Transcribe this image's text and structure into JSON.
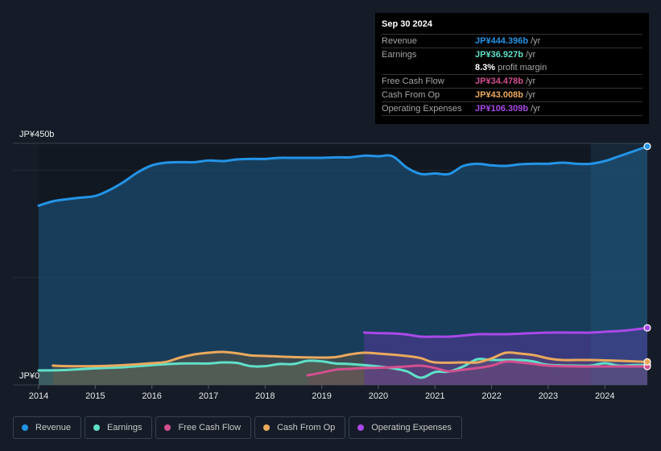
{
  "tooltip": {
    "date": "Sep 30 2024",
    "rows": [
      {
        "label": "Revenue",
        "value": "JP¥444.396b",
        "unit": "/yr",
        "color": "#2394e6"
      },
      {
        "label": "Earnings",
        "value": "JP¥36.927b",
        "unit": "/yr",
        "color": "#5fe0c8"
      },
      {
        "label": "",
        "value": "8.3%",
        "unit": "profit margin",
        "color": "#ffffff"
      },
      {
        "label": "Free Cash Flow",
        "value": "JP¥34.478b",
        "unit": "/yr",
        "color": "#d34f8f"
      },
      {
        "label": "Cash From Op",
        "value": "JP¥43.008b",
        "unit": "/yr",
        "color": "#eaa95d"
      },
      {
        "label": "Operating Expenses",
        "value": "JP¥106.309b",
        "unit": "/yr",
        "color": "#a949e8"
      }
    ]
  },
  "legend": [
    {
      "label": "Revenue",
      "color": "#2394e6"
    },
    {
      "label": "Earnings",
      "color": "#5fe0c8"
    },
    {
      "label": "Free Cash Flow",
      "color": "#d34f8f"
    },
    {
      "label": "Cash From Op",
      "color": "#eaa95d"
    },
    {
      "label": "Operating Expenses",
      "color": "#a949e8"
    }
  ],
  "chart_data": {
    "type": "area",
    "title": "",
    "xlabel": "",
    "ylabel": "",
    "y_tick_labels": [
      "JP¥0",
      "JP¥450b"
    ],
    "ylim": [
      0,
      450
    ],
    "xlim": [
      2014,
      2024.75
    ],
    "x_ticks": [
      2014,
      2015,
      2016,
      2017,
      2018,
      2019,
      2020,
      2021,
      2022,
      2023,
      2024
    ],
    "x_tick_labels": [
      "2014",
      "2015",
      "2016",
      "2017",
      "2018",
      "2019",
      "2020",
      "2021",
      "2022",
      "2023",
      "2024"
    ],
    "gridlines_at": [
      200,
      400,
      450
    ],
    "highlight_range": [
      2023.75,
      2024.75
    ],
    "units": "JP¥ billions",
    "series": [
      {
        "name": "Revenue",
        "color": "#2394e6",
        "x": [
          2014,
          2014.25,
          2014.5,
          2014.75,
          2015,
          2015.25,
          2015.5,
          2015.75,
          2016,
          2016.25,
          2016.5,
          2016.75,
          2017,
          2017.25,
          2017.5,
          2017.75,
          2018,
          2018.25,
          2018.5,
          2018.75,
          2019,
          2019.25,
          2019.5,
          2019.75,
          2020,
          2020.25,
          2020.5,
          2020.75,
          2021,
          2021.25,
          2021.5,
          2021.75,
          2022,
          2022.25,
          2022.5,
          2022.75,
          2023,
          2023.25,
          2023.5,
          2023.75,
          2024,
          2024.25,
          2024.5,
          2024.75
        ],
        "values": [
          334,
          342,
          346,
          349,
          352,
          363,
          378,
          396,
          409,
          414,
          415,
          415,
          418,
          417,
          420,
          421,
          421,
          423,
          423,
          423,
          423,
          424,
          424,
          427,
          426,
          426,
          405,
          393,
          394,
          393,
          408,
          412,
          409,
          408,
          411,
          412,
          412,
          414,
          412,
          412,
          417,
          426,
          435,
          444.4
        ]
      },
      {
        "name": "Earnings",
        "color": "#5fe0c8",
        "x": [
          2014,
          2014.5,
          2015,
          2015.5,
          2016,
          2016.5,
          2017,
          2017.25,
          2017.5,
          2017.75,
          2018,
          2018.25,
          2018.5,
          2018.75,
          2019,
          2019.25,
          2019.5,
          2020,
          2020.25,
          2020.5,
          2020.75,
          2021,
          2021.25,
          2021.5,
          2021.75,
          2022,
          2022.5,
          2022.75,
          2023,
          2023.5,
          2023.75,
          2024,
          2024.25,
          2024.5,
          2024.75
        ],
        "values": [
          27,
          28,
          31,
          33,
          37,
          40,
          40,
          42,
          41,
          35,
          35,
          39,
          39,
          45,
          44,
          40,
          39,
          34.5,
          31,
          25.5,
          13.5,
          24,
          25,
          34.5,
          48,
          46.5,
          46.5,
          43.5,
          37.5,
          36,
          36,
          40.5,
          36,
          37,
          36.9
        ]
      },
      {
        "name": "Free Cash Flow",
        "color": "#d34f8f",
        "x": [
          2018.75,
          2019,
          2019.25,
          2019.5,
          2019.75,
          2020,
          2020.25,
          2020.5,
          2020.75,
          2021,
          2021.25,
          2021.5,
          2021.75,
          2022,
          2022.25,
          2022.5,
          2022.75,
          2023,
          2023.5,
          2024,
          2024.5,
          2024.75
        ],
        "values": [
          18,
          23,
          28.5,
          30,
          31.5,
          32,
          33,
          34.5,
          36,
          31.5,
          25.5,
          28.5,
          31.5,
          36,
          43.5,
          42,
          39,
          36,
          34.5,
          34.5,
          34.5,
          34.5
        ]
      },
      {
        "name": "Cash From Op",
        "color": "#eaa95d",
        "x": [
          2014.25,
          2014.5,
          2015,
          2015.5,
          2016,
          2016.25,
          2016.5,
          2016.75,
          2017,
          2017.25,
          2017.5,
          2017.75,
          2018,
          2018.5,
          2019,
          2019.25,
          2019.5,
          2019.75,
          2020,
          2020.5,
          2020.75,
          2021,
          2021.5,
          2021.75,
          2022,
          2022.25,
          2022.5,
          2022.75,
          2023,
          2023.25,
          2023.75,
          2024.25,
          2024.75
        ],
        "values": [
          36,
          35,
          35,
          37,
          40.5,
          43,
          51,
          57,
          60,
          61.5,
          59,
          55,
          54,
          52,
          51,
          52,
          57,
          60,
          58.5,
          54,
          50,
          42,
          42,
          42,
          49.5,
          60,
          58.5,
          55.5,
          49.5,
          46.5,
          46.5,
          45,
          43
        ]
      },
      {
        "name": "Operating Expenses",
        "color": "#a949e8",
        "x": [
          2019.75,
          2020,
          2020.25,
          2020.5,
          2020.75,
          2021,
          2021.25,
          2021.5,
          2021.75,
          2022,
          2022.25,
          2022.5,
          2023,
          2023.5,
          2023.75,
          2024,
          2024.25,
          2024.5,
          2024.75
        ],
        "values": [
          97.5,
          96.5,
          96,
          94,
          90,
          90,
          90,
          92,
          94.5,
          94.5,
          94.5,
          95.5,
          97.5,
          97.5,
          97.5,
          99,
          100.5,
          103,
          106.3
        ]
      }
    ]
  }
}
